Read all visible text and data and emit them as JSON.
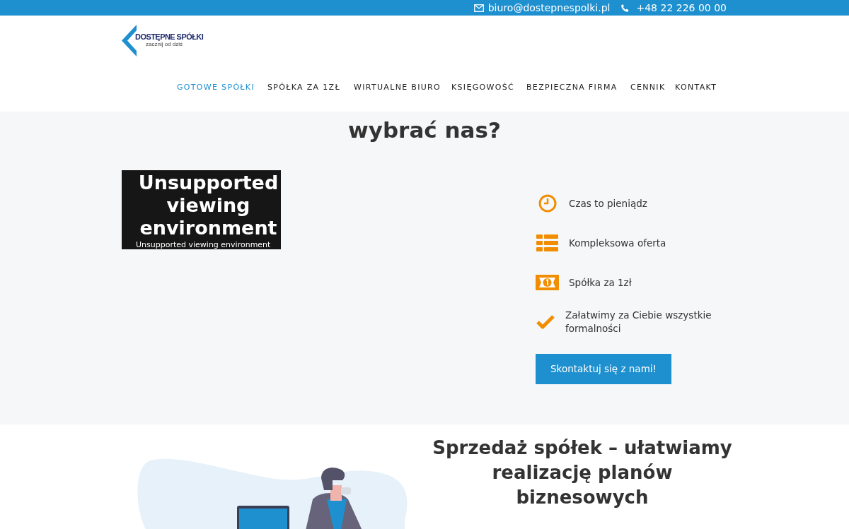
{
  "top_bar": {
    "email": "biuro@dostepnespolki.pl",
    "phone": "+48 22 226 00 00"
  },
  "logo": {
    "name": "DOSTĘPNE SPÓŁKI",
    "tagline": "zacznij od dziś"
  },
  "nav": [
    {
      "label": "GOTOWE SPÓŁKI",
      "selected": true
    },
    {
      "label": "SPÓŁKA ZA 1ZŁ",
      "selected": false
    },
    {
      "label": "WIRTUALNE BIURO",
      "selected": false
    },
    {
      "label": "KSIĘGOWOŚĆ",
      "selected": false
    },
    {
      "label": "BEZPIECZNA FIRMA",
      "selected": false
    },
    {
      "label": "CENNIK",
      "selected": false
    },
    {
      "label": "KONTAKT",
      "selected": false
    }
  ],
  "why_section": {
    "heading": "wybrać nas?",
    "video": {
      "title": "Unsupported viewing environment",
      "caption": "Unsupported viewing environment"
    },
    "features": [
      {
        "kind": "clock",
        "text": "Czas to pieniądz"
      },
      {
        "kind": "list",
        "text": "Kompleksowa oferta"
      },
      {
        "kind": "money",
        "text": "Spółka za 1zł"
      },
      {
        "kind": "check",
        "text": "Załatwimy za Ciebie wszystkie formalności"
      }
    ],
    "button": "Skontaktuj się z nami!"
  },
  "sales_section": {
    "heading": "Sprzedaż spółek – ułatwiamy realizację planów biznesowych"
  }
}
